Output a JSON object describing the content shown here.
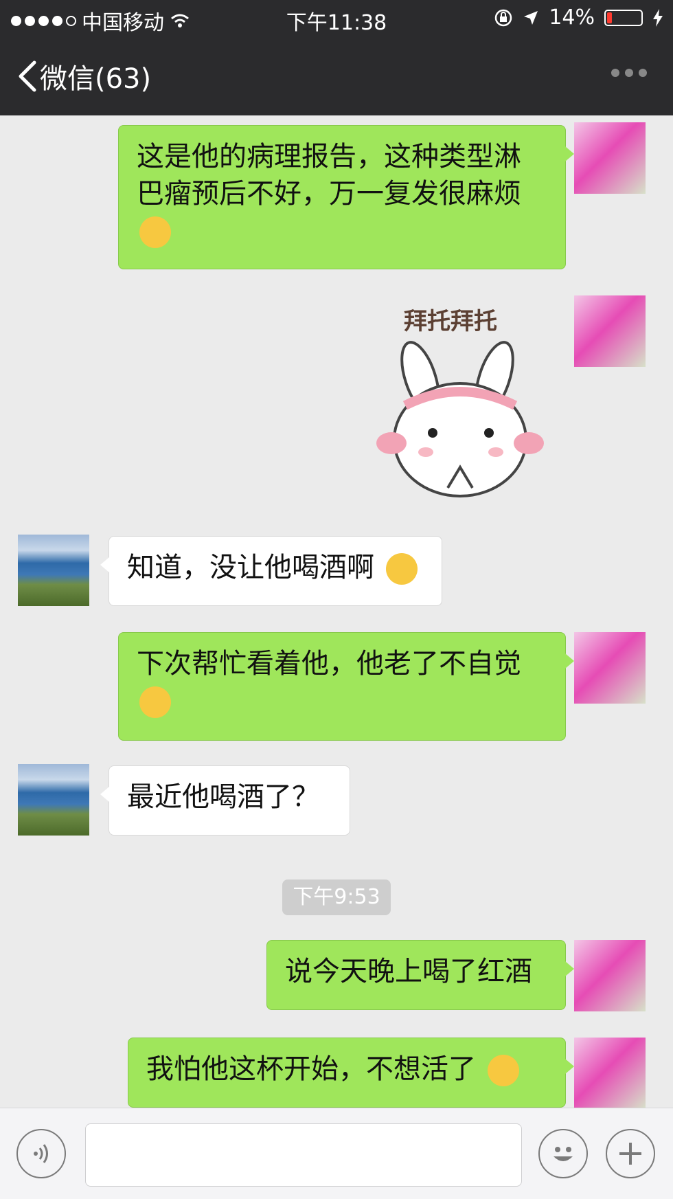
{
  "status_bar": {
    "carrier": "中国移动",
    "time": "下午11:38",
    "battery": "14%",
    "battery_level": 0.14
  },
  "nav": {
    "back_label": "微信(63)"
  },
  "messages": [
    {
      "side": "out",
      "text": "这是他的病理报告，这种类型淋巴瘤预后不好，万一复发很麻烦",
      "emoji": "face-palm-emoji"
    },
    {
      "side": "out",
      "sticker_caption": "拜托拜托",
      "sticker": "bunny-please-sticker"
    },
    {
      "side": "in",
      "text": "知道，没让他喝酒啊",
      "emoji": "pleading-face-emoji"
    },
    {
      "side": "out",
      "text": "下次帮忙看着他，他老了不自觉",
      "emoji": "face-palm-emoji"
    },
    {
      "side": "in",
      "text": "最近他喝酒了？"
    },
    {
      "type": "time",
      "text": "下午9:53"
    },
    {
      "side": "out",
      "text": "说今天晚上喝了红酒"
    },
    {
      "side": "out",
      "text": "我怕他这杯开始，不想活了",
      "emoji": "tears-of-joy-emoji"
    }
  ],
  "input_bar": {
    "voice_icon": "voice-icon",
    "emoji_icon": "emoji-icon",
    "plus_icon": "plus-icon"
  }
}
